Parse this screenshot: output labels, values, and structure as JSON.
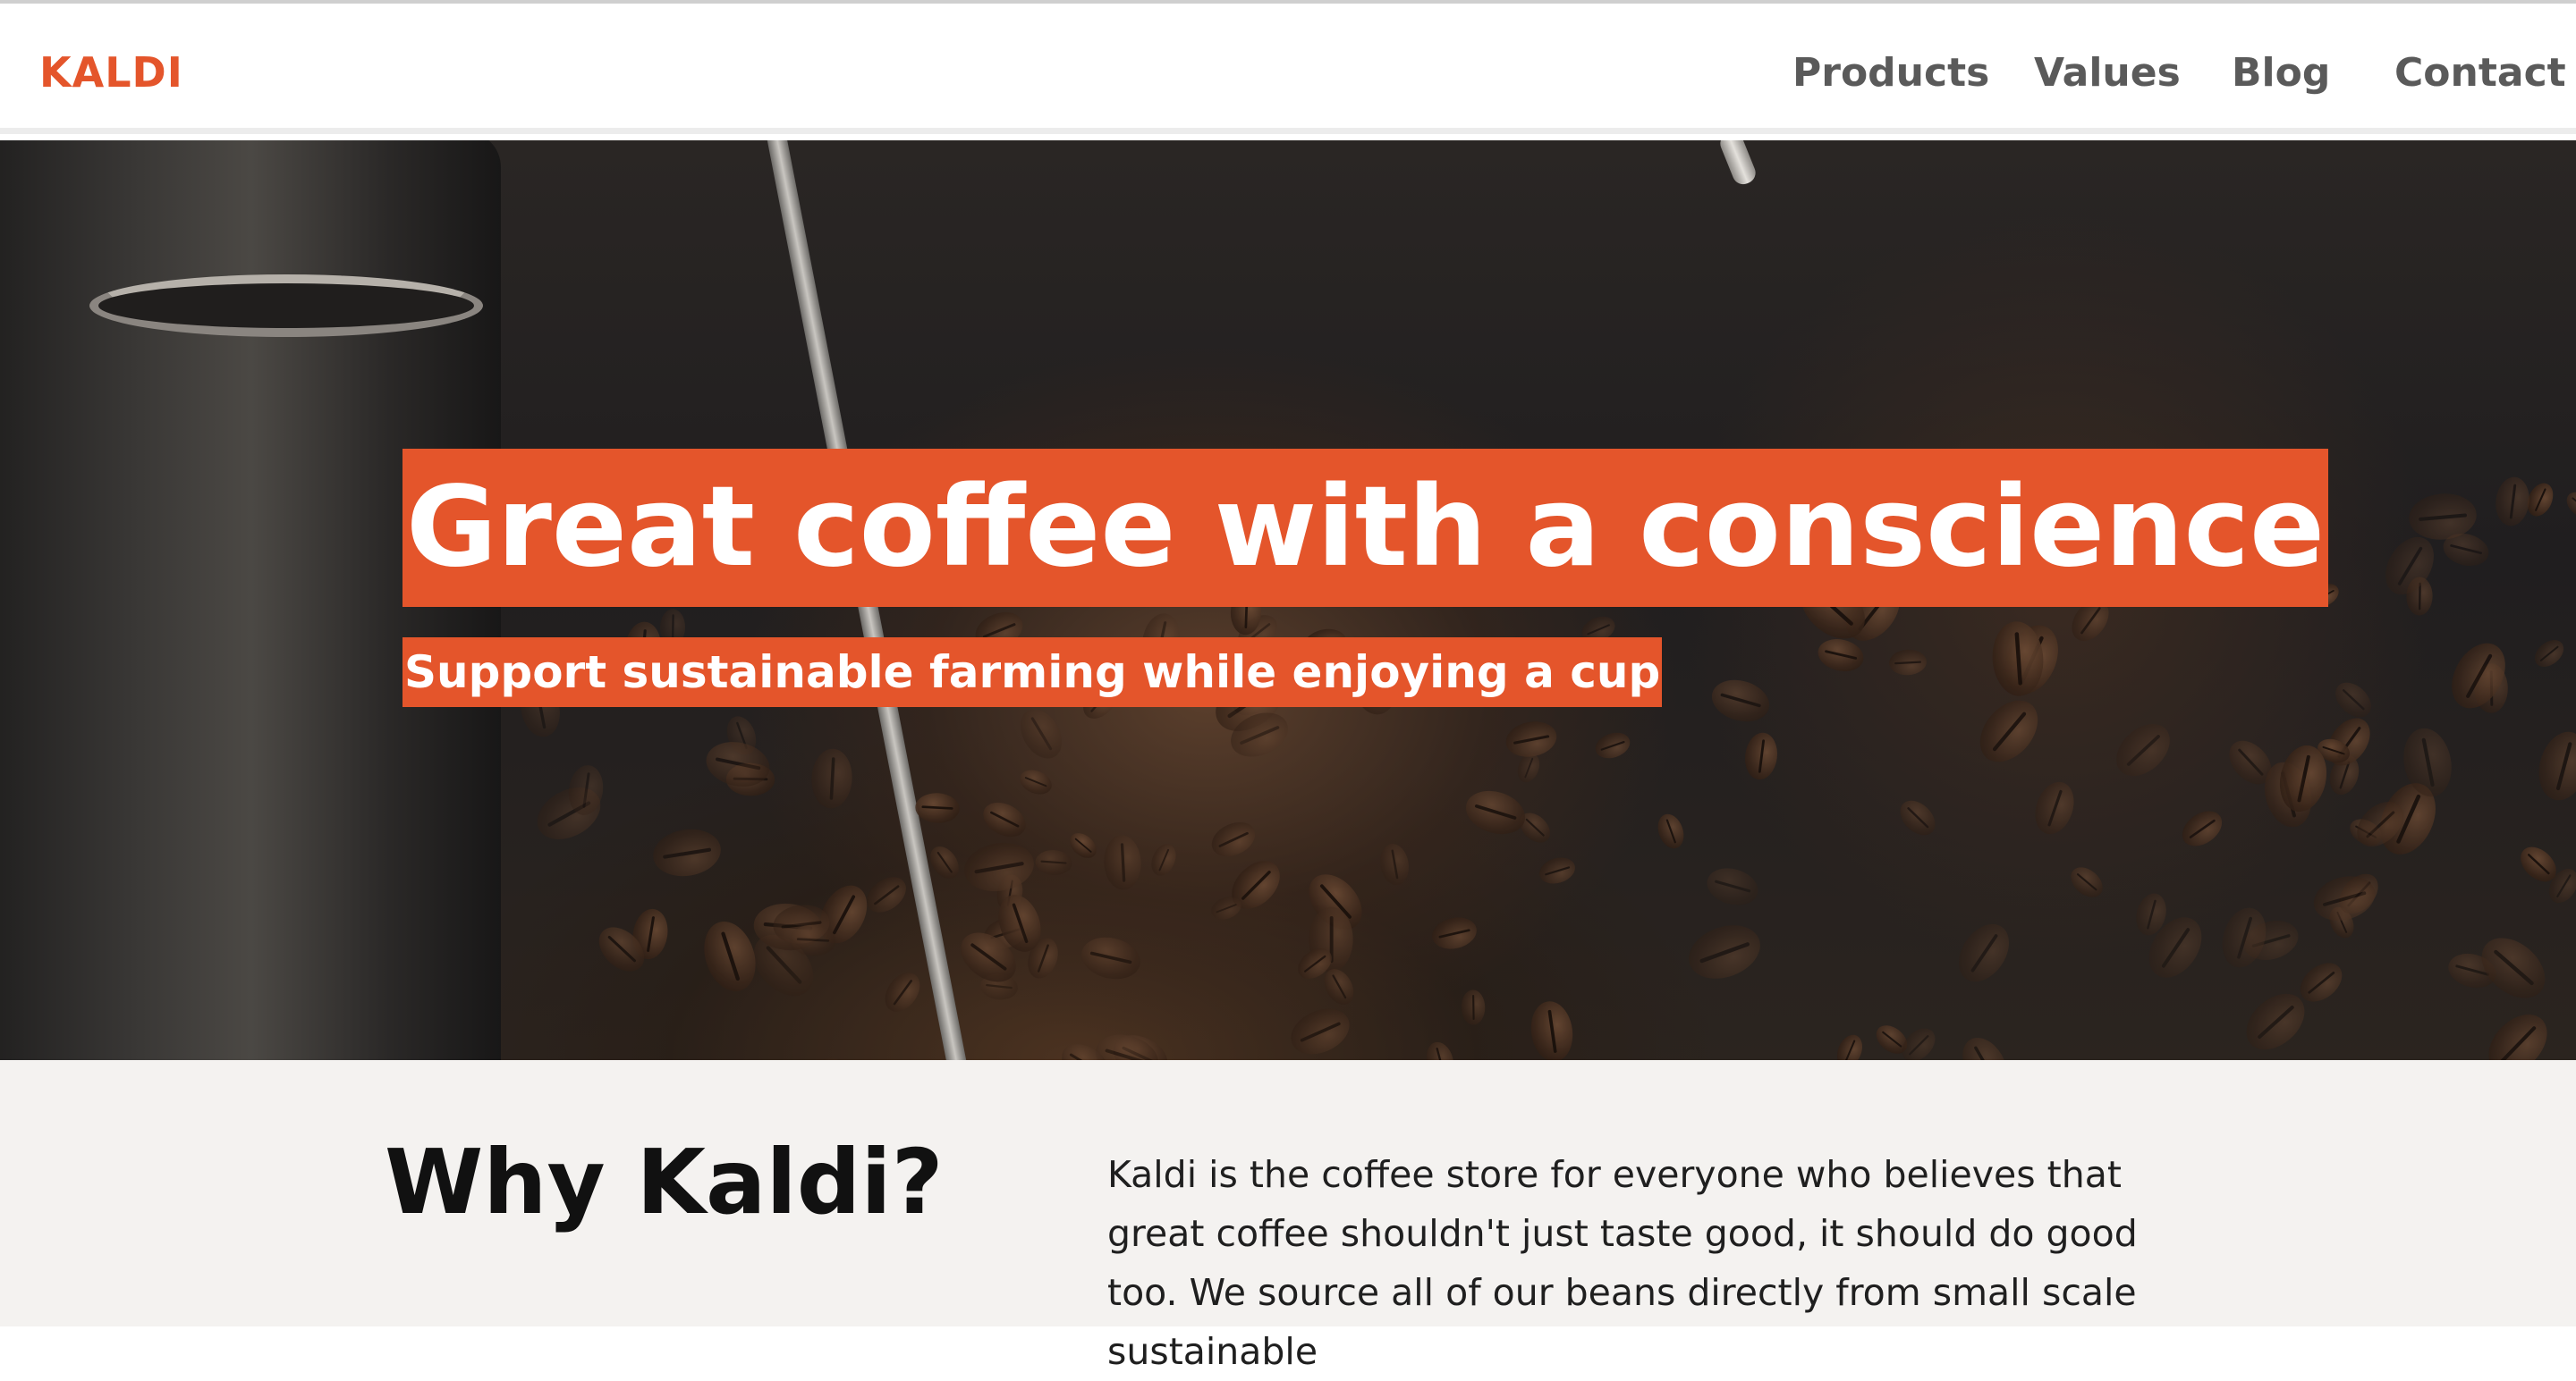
{
  "header": {
    "logo": "KALDI",
    "nav": [
      {
        "label": "Products"
      },
      {
        "label": "Values"
      },
      {
        "label": "Blog"
      },
      {
        "label": "Contact"
      }
    ]
  },
  "hero": {
    "title": "Great coffee with a conscience",
    "subtitle": "Support sustainable farming while enjoying a cup"
  },
  "why": {
    "heading": "Why Kaldi?",
    "body": "Kaldi is the coffee store for everyone who believes that great coffee shouldn't just taste good, it should do good too. We source all of our beans directly from small scale sustainable"
  },
  "colors": {
    "accent": "#e4552b",
    "nav_text": "#5a5a5a",
    "section_bg": "#f4f2f0"
  }
}
